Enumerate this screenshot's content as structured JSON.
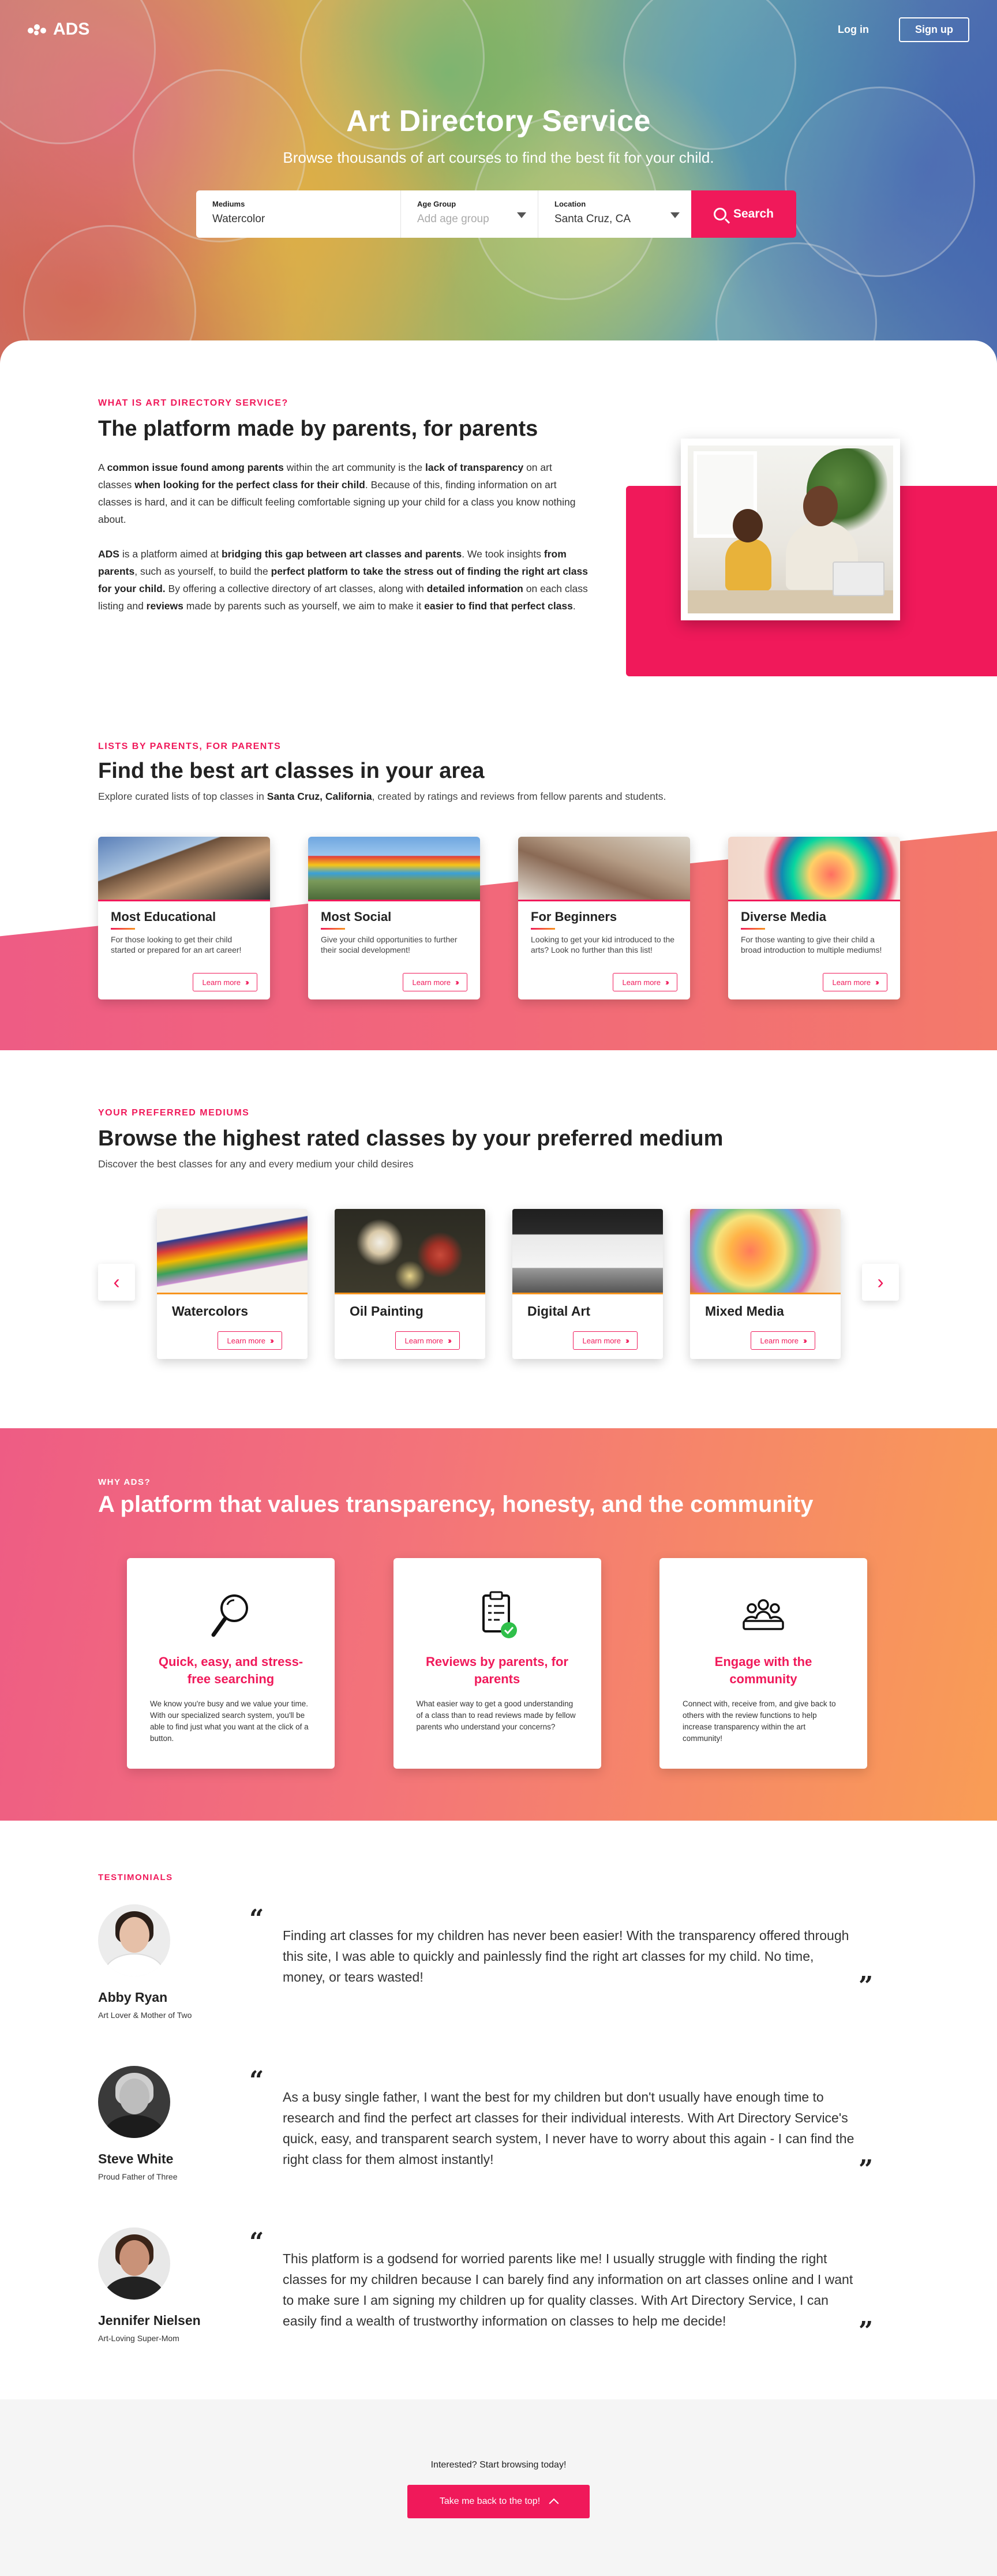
{
  "brand": {
    "name": "ADS",
    "accent": "#f0195a",
    "accent2": "#f7941d"
  },
  "nav": {
    "login_label": "Log in",
    "signup_label": "Sign up"
  },
  "hero": {
    "title": "Art Directory Service",
    "subtitle": "Browse thousands of art courses to find the best fit for your child."
  },
  "search": {
    "mediums_label": "Mediums",
    "mediums_value": "Watercolor",
    "age_label": "Age Group",
    "age_placeholder": "Add age group",
    "location_label": "Location",
    "location_value": "Santa Cruz, CA",
    "button_label": "Search",
    "icon": "search-icon"
  },
  "about": {
    "eyebrow": "WHAT IS ART DIRECTORY SERVICE?",
    "title": "The platform made by parents, for parents",
    "p1": [
      {
        "t": "A "
      },
      {
        "t": "common issue found among parents",
        "b": true
      },
      {
        "t": " within the art community is the "
      },
      {
        "t": "lack of transparency",
        "b": true
      },
      {
        "t": " on art classes "
      },
      {
        "t": "when looking for the perfect class for their child",
        "b": true
      },
      {
        "t": ". Because of this, finding information on art classes is hard, and it can be difficult feeling comfortable signing up your child for a class you know nothing about."
      }
    ],
    "p2": [
      {
        "t": "ADS",
        "b": true
      },
      {
        "t": " is a platform aimed at "
      },
      {
        "t": "bridging this gap between art classes and parents",
        "b": true
      },
      {
        "t": ". We took insights "
      },
      {
        "t": "from parents",
        "b": true
      },
      {
        "t": ", such as yourself, to build the "
      },
      {
        "t": "perfect platform to take the stress out of finding the right art class for your child.",
        "b": true
      },
      {
        "t": " By offering a collective directory of art classes, along with "
      },
      {
        "t": "detailed information",
        "b": true
      },
      {
        "t": " on each class listing and "
      },
      {
        "t": "reviews",
        "b": true
      },
      {
        "t": " made by parents such as yourself, we aim to make it "
      },
      {
        "t": "easier to find that perfect class",
        "b": true
      },
      {
        "t": "."
      }
    ]
  },
  "lists": {
    "eyebrow": "LISTS BY PARENTS, FOR PARENTS",
    "title": "Find the best art classes in your area",
    "sub": [
      {
        "t": "Explore curated lists of top classes in "
      },
      {
        "t": "Santa Cruz, California",
        "b": true
      },
      {
        "t": ", created by ratings and reviews from fellow parents and students."
      }
    ],
    "cards": [
      {
        "title": "Most Educational",
        "text": "For those looking to get their child started or prepared for an art career!",
        "button": "Learn more"
      },
      {
        "title": "Most Social",
        "text": "Give your child opportunities to further their social development!",
        "button": "Learn more"
      },
      {
        "title": "For Beginners",
        "text": "Looking to get your kid introduced to the arts? Look no further than this list!",
        "button": "Learn more"
      },
      {
        "title": "Diverse Media",
        "text": "For those wanting to give their child a broad introduction to multiple mediums!",
        "button": "Learn more"
      }
    ]
  },
  "mediums": {
    "eyebrow": "YOUR PREFERRED MEDIUMS",
    "title": "Browse the highest rated classes by your preferred medium",
    "sub": "Discover the best classes for any and every medium your child desires",
    "prev_icon": "chevron-left-icon",
    "next_icon": "chevron-right-icon",
    "cards": [
      {
        "title": "Watercolors",
        "button": "Learn more"
      },
      {
        "title": "Oil Painting",
        "button": "Learn more"
      },
      {
        "title": "Digital Art",
        "button": "Learn more"
      },
      {
        "title": "Mixed Media",
        "button": "Learn more"
      }
    ]
  },
  "why": {
    "eyebrow": "WHY ADS?",
    "title": "A platform that values transparency, honesty, and the community",
    "cards": [
      {
        "icon": "magnifier-icon",
        "title": "Quick, easy, and stress-free searching",
        "text": "We know you're busy and we value your time. With our specialized search system, you'll be able to find just what you want at the click of a button."
      },
      {
        "icon": "clipboard-check-icon",
        "title": "Reviews by parents, for parents",
        "text": "What easier way to get a good understanding of a class than to read reviews made by fellow parents who understand your concerns?"
      },
      {
        "icon": "community-icon",
        "title": "Engage with the community",
        "text": "Connect with, receive from, and give back to others with the review functions to help increase transparency within the art community!"
      }
    ]
  },
  "testimonials": {
    "eyebrow": "TESTIMONIALS",
    "items": [
      {
        "name": "Abby Ryan",
        "role": "Art Lover & Mother of Two",
        "quote": "Finding art classes for my children has never been easier! With the transparency offered through this site, I was able to quickly and painlessly find the right art classes for my child. No time, money, or tears wasted!"
      },
      {
        "name": "Steve White",
        "role": "Proud Father of Three",
        "quote": "As a busy single father, I want the best for my children but don't usually have enough time to research and find the perfect art classes for their individual interests. With Art Directory Service's quick, easy, and transparent search system, I never have to worry about this again - I can find the right class for them almost instantly!"
      },
      {
        "name": "Jennifer Nielsen",
        "role": "Art-Loving Super-Mom",
        "quote": "This platform is a godsend for worried parents like me! I usually struggle with finding the right classes for my children because I can barely find any information on art classes online and I want to make sure I am signing my children up for quality classes. With Art Directory Service, I can easily find a wealth of trustworthy information on classes to help me decide!"
      }
    ]
  },
  "footer": {
    "text": "Interested? Start browsing today!",
    "button_label": "Take me back to the top!"
  }
}
